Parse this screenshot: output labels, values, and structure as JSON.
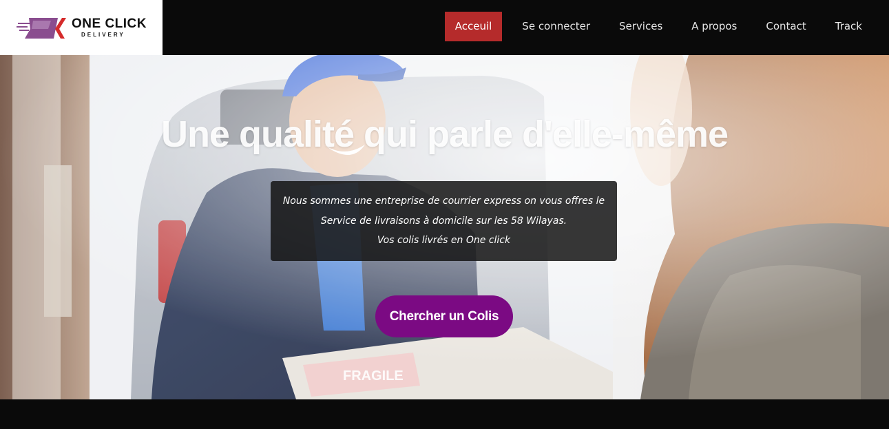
{
  "brand": {
    "name": "ONE CLICK",
    "tagline": "DELIVERY",
    "colors": {
      "purple": "#8a4d8f",
      "red": "#d52b2b"
    }
  },
  "nav": {
    "items": [
      {
        "label": "Acceuil",
        "active": true
      },
      {
        "label": "Se connecter",
        "active": false
      },
      {
        "label": "Services",
        "active": false
      },
      {
        "label": "A propos",
        "active": false
      },
      {
        "label": "Contact",
        "active": false
      },
      {
        "label": "Track",
        "active": false
      }
    ],
    "active_color": "#b52b2b"
  },
  "hero": {
    "title": "Une qualité qui parle d'elle-même",
    "description_lines": [
      "Nous sommes une entreprise de courrier express on vous offres le",
      "Service de livraisons à domicile sur les 58 Wilayas.",
      "Vos colis livrés en One click"
    ],
    "box_label": "FRAGILE",
    "cta_label": "Chercher un Colis",
    "cta_color": "#7b0a83"
  }
}
